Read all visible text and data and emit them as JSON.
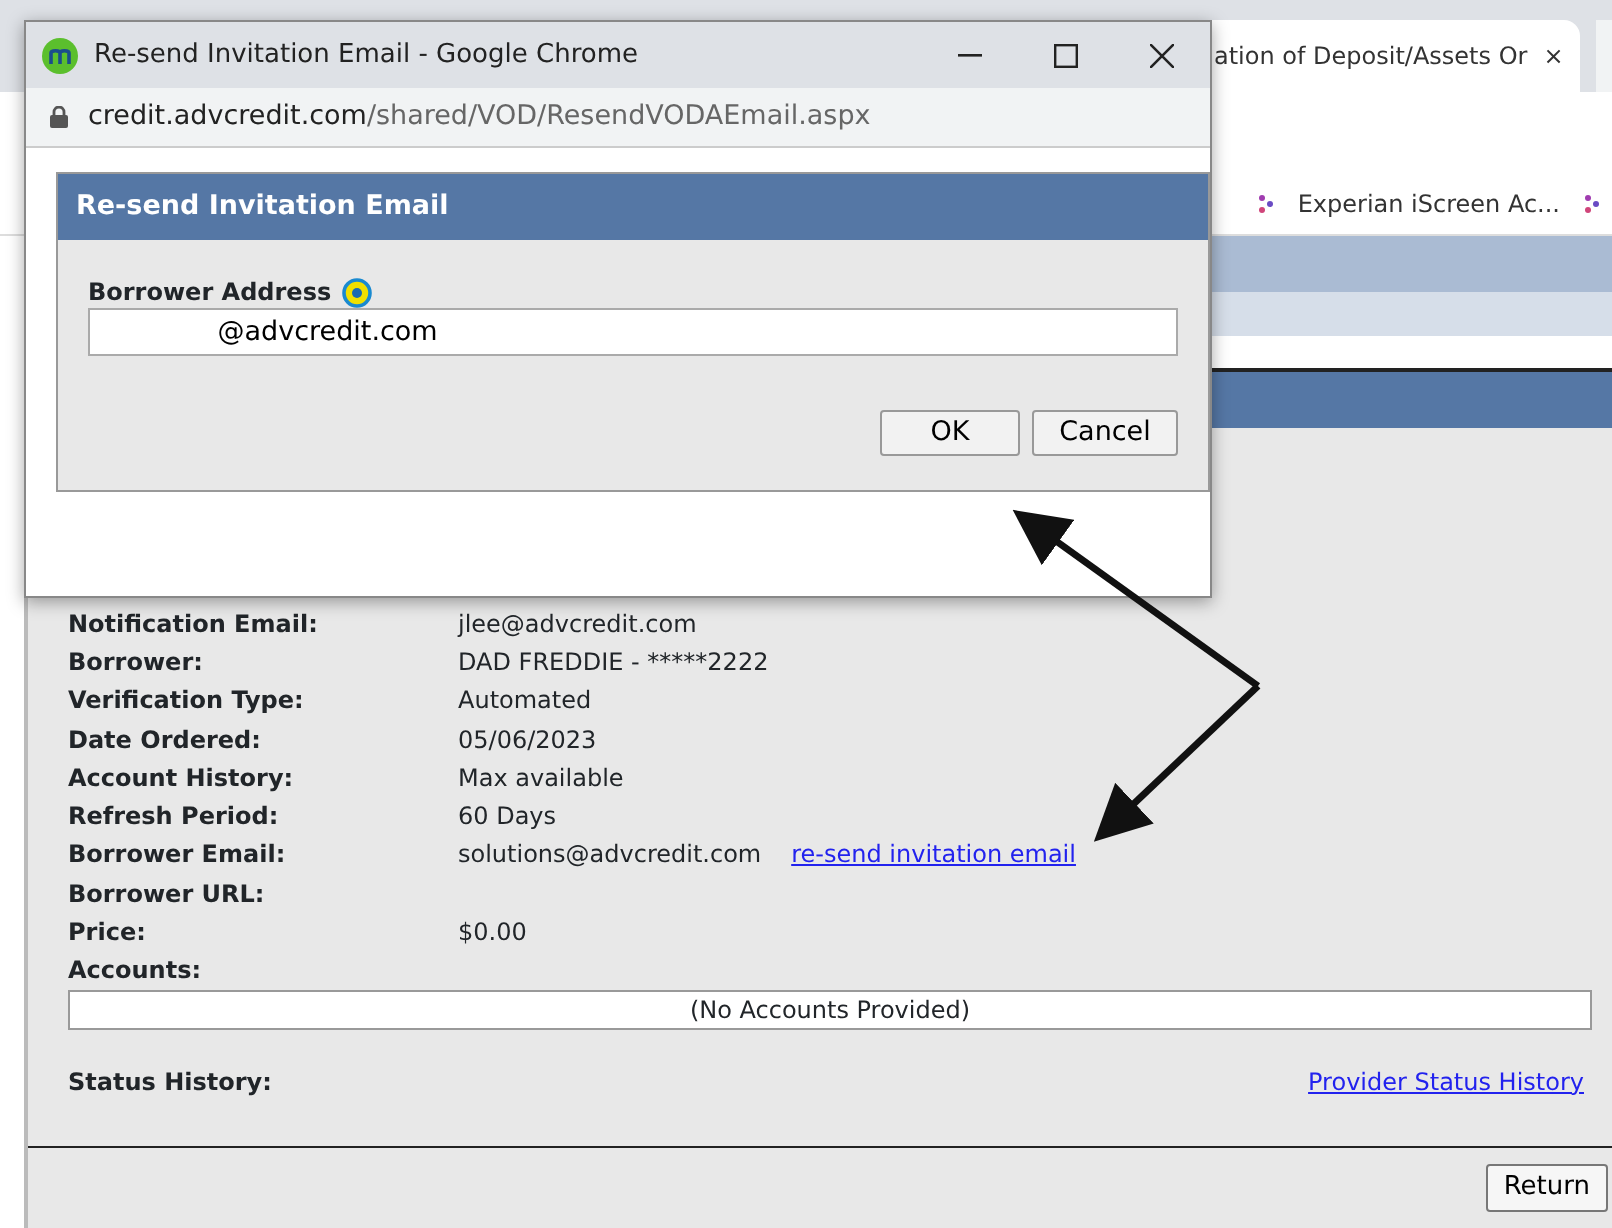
{
  "browser": {
    "tab_title": "ation of Deposit/Assets Or",
    "tab_close": "×",
    "bookmark": "Experian iScreen Ac..."
  },
  "details": [
    {
      "label": "Notification Email:",
      "value": "jlee@advcredit.com"
    },
    {
      "label": "Borrower:",
      "value": "DAD FREDDIE - *****2222"
    },
    {
      "label": "Verification Type:",
      "value": "Automated"
    },
    {
      "label": "Date Ordered:",
      "value": "05/06/2023"
    },
    {
      "label": "Account History:",
      "value": "Max available"
    },
    {
      "label": "Refresh Period:",
      "value": "60 Days"
    },
    {
      "label": "Borrower Email:",
      "value": "solutions@advcredit.com",
      "link": "re-send invitation email"
    },
    {
      "label": "Borrower URL:"
    },
    {
      "label": "Price:",
      "value": "$0.00"
    }
  ],
  "accounts": {
    "label": "Accounts:",
    "empty_text": "(No Accounts Provided)"
  },
  "status_history": {
    "label": "Status History:",
    "link": "Provider Status History"
  },
  "return_button": "Return",
  "popup": {
    "title": "Re-send Invitation Email - Google Chrome",
    "url_host": "credit.advcredit.com",
    "url_path": "/shared/VOD/ResendVODAEmail.aspx",
    "dialog": {
      "title": "Re-send Invitation Email",
      "field_label": "Borrower Address",
      "field_value": "             @advcredit.com",
      "buttons": [
        "OK",
        "Cancel"
      ]
    }
  }
}
